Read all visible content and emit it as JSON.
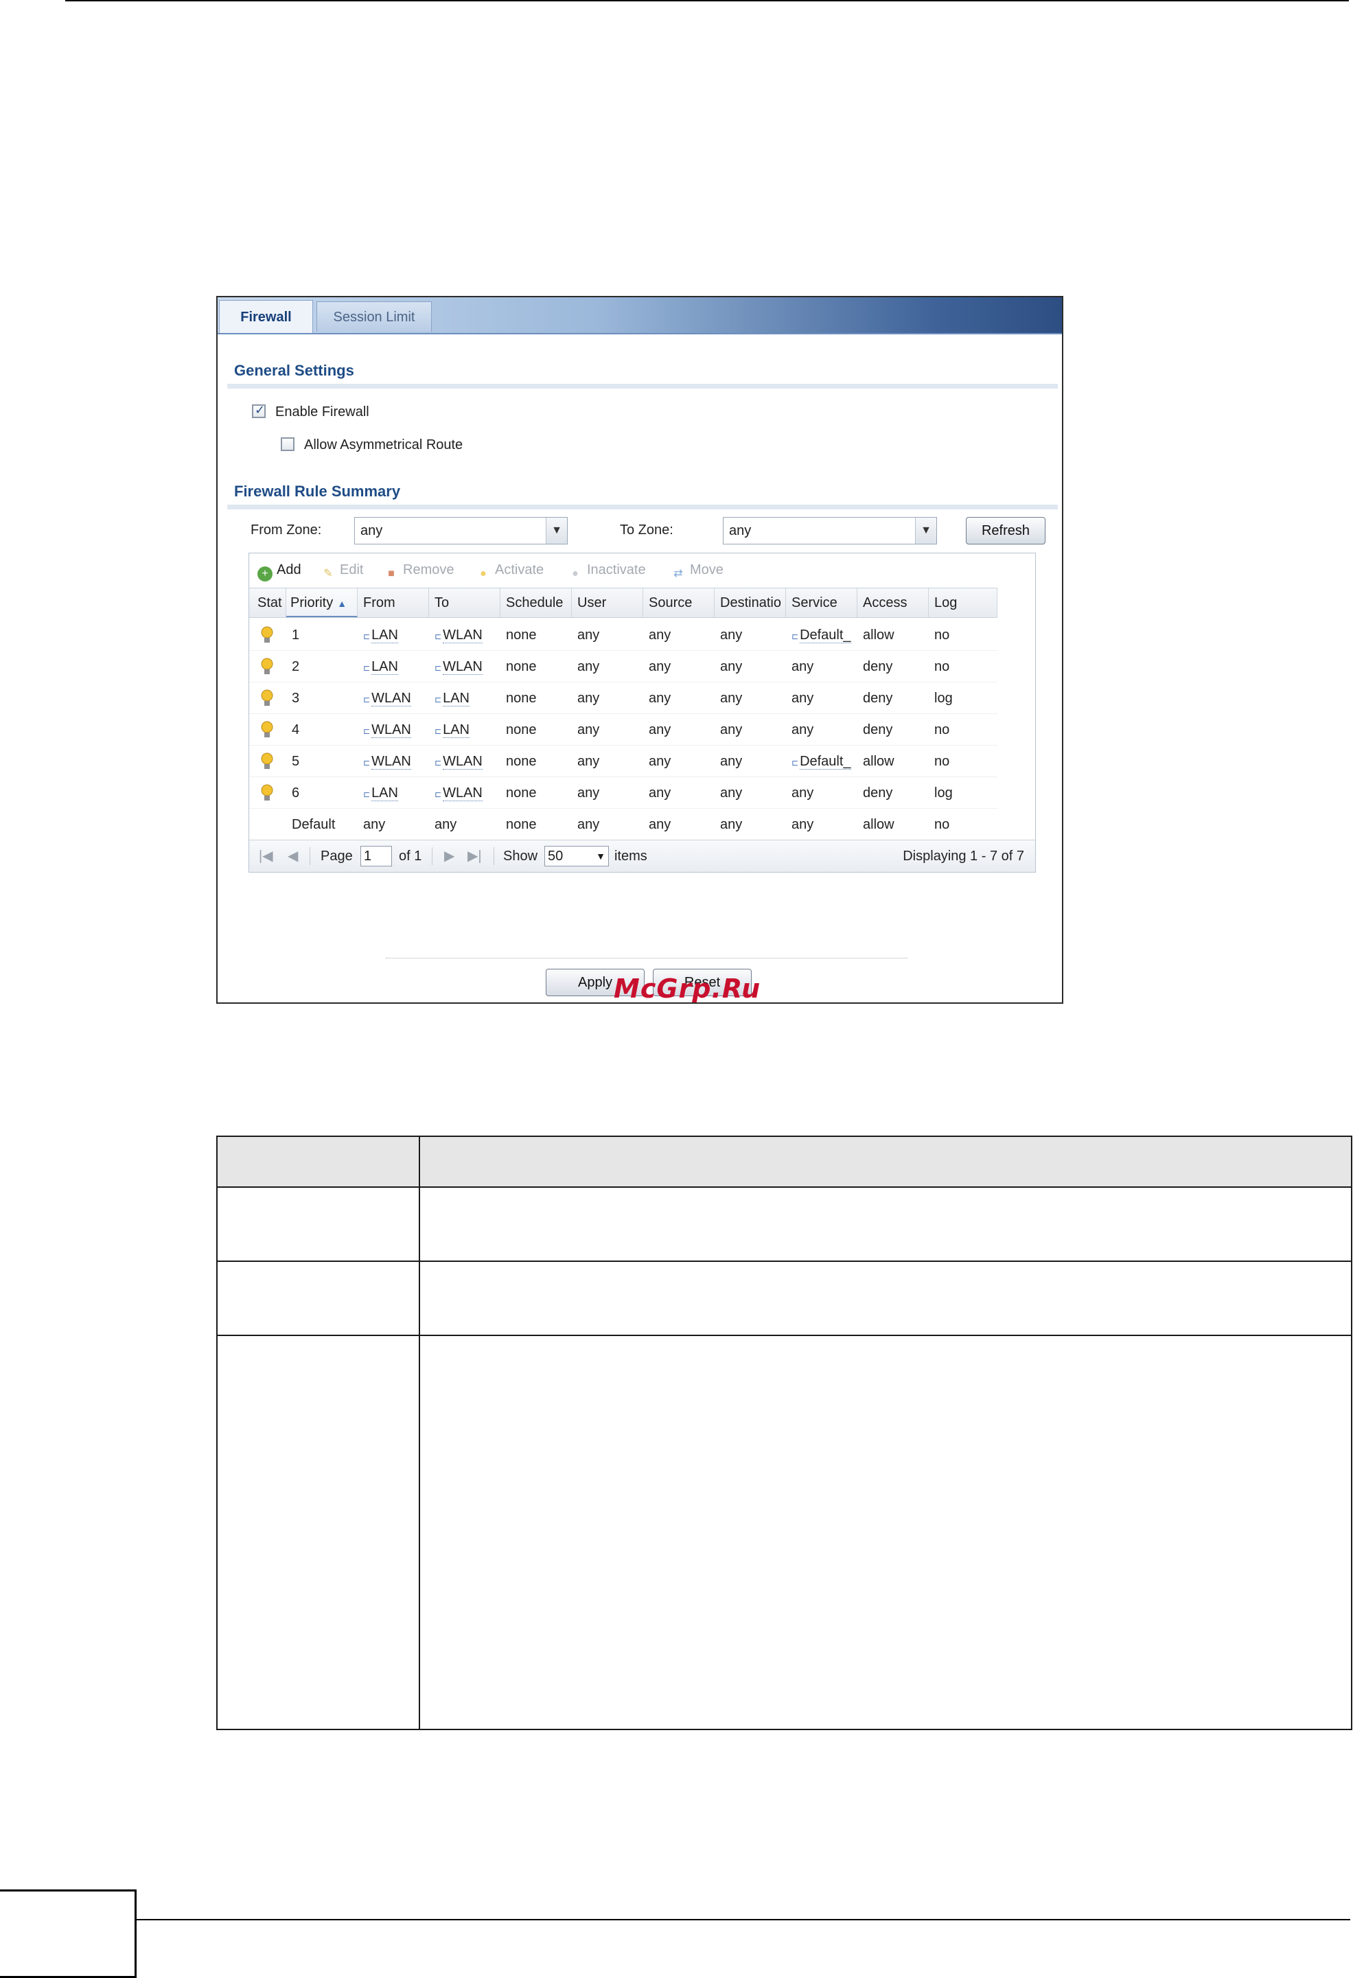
{
  "tabs": [
    {
      "label": "Firewall"
    },
    {
      "label": "Session Limit"
    }
  ],
  "general": {
    "title": "General Settings",
    "enable_firewall": {
      "label": "Enable Firewall",
      "checked": true
    },
    "allow_asym": {
      "label": "Allow Asymmetrical Route",
      "checked": false
    }
  },
  "summary": {
    "title": "Firewall Rule Summary",
    "from_zone_label": "From Zone:",
    "from_zone_value": "any",
    "to_zone_label": "To Zone:",
    "to_zone_value": "any",
    "refresh_label": "Refresh"
  },
  "toolbar": {
    "add": "Add",
    "edit": "Edit",
    "remove": "Remove",
    "activate": "Activate",
    "inactivate": "Inactivate",
    "move": "Move"
  },
  "columns": [
    "Stat",
    "Priority",
    "From",
    "To",
    "Schedule",
    "User",
    "Source",
    "Destinatio",
    "Service",
    "Access",
    "Log"
  ],
  "rules": [
    {
      "priority": "1",
      "from": "LAN",
      "to": "WLAN",
      "schedule": "none",
      "user": "any",
      "source": "any",
      "destination": "any",
      "service": "Default_",
      "access": "allow",
      "log": "no"
    },
    {
      "priority": "2",
      "from": "LAN",
      "to": "WLAN",
      "schedule": "none",
      "user": "any",
      "source": "any",
      "destination": "any",
      "service": "any",
      "access": "deny",
      "log": "no"
    },
    {
      "priority": "3",
      "from": "WLAN",
      "to": "LAN",
      "schedule": "none",
      "user": "any",
      "source": "any",
      "destination": "any",
      "service": "any",
      "access": "deny",
      "log": "log"
    },
    {
      "priority": "4",
      "from": "WLAN",
      "to": "LAN",
      "schedule": "none",
      "user": "any",
      "source": "any",
      "destination": "any",
      "service": "any",
      "access": "deny",
      "log": "no"
    },
    {
      "priority": "5",
      "from": "WLAN",
      "to": "WLAN",
      "schedule": "none",
      "user": "any",
      "source": "any",
      "destination": "any",
      "service": "Default_",
      "access": "allow",
      "log": "no"
    },
    {
      "priority": "6",
      "from": "LAN",
      "to": "WLAN",
      "schedule": "none",
      "user": "any",
      "source": "any",
      "destination": "any",
      "service": "any",
      "access": "deny",
      "log": "log"
    },
    {
      "priority": "Default",
      "from": "any",
      "to": "any",
      "schedule": "none",
      "user": "any",
      "source": "any",
      "destination": "any",
      "service": "any",
      "access": "allow",
      "log": "no"
    }
  ],
  "pager": {
    "page_label": "Page",
    "page_value": "1",
    "of_label": "of 1",
    "show_label": "Show",
    "show_value": "50",
    "items_label": "items",
    "displaying": "Displaying 1 - 7 of 7"
  },
  "buttons": {
    "apply": "Apply",
    "reset": "Reset"
  },
  "watermark": "McGrp.Ru",
  "colors": {
    "accent": "#1e4c86",
    "bulb": "#f2c230",
    "watermark": "#c8102e"
  }
}
